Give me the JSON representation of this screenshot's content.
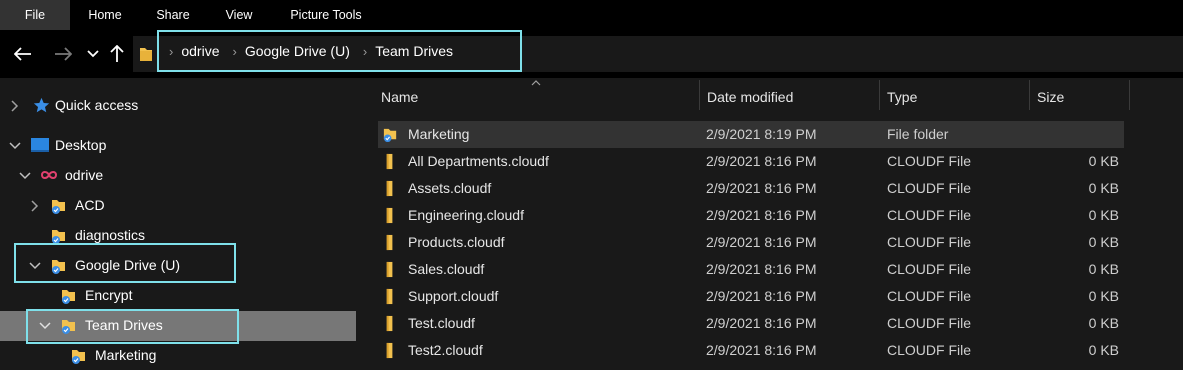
{
  "ribbon": {
    "tabs": [
      {
        "label": "File"
      },
      {
        "label": "Home"
      },
      {
        "label": "Share"
      },
      {
        "label": "View"
      },
      {
        "label": "Picture Tools"
      }
    ]
  },
  "address_bar": {
    "breadcrumb": [
      "odrive",
      "Google Drive (U)",
      "Team Drives"
    ]
  },
  "nav_pane": {
    "items": [
      {
        "label": "Quick access",
        "icon": "star-icon"
      },
      {
        "label": "Desktop",
        "icon": "desktop-icon"
      },
      {
        "label": "odrive",
        "icon": "odrive-infinity-icon"
      },
      {
        "label": "ACD",
        "icon": "sync-folder-icon"
      },
      {
        "label": "diagnostics",
        "icon": "sync-folder-icon"
      },
      {
        "label": "Google Drive (U)",
        "icon": "sync-folder-icon"
      },
      {
        "label": "Encrypt",
        "icon": "sync-folder-icon"
      },
      {
        "label": "Team Drives",
        "icon": "sync-folder-icon"
      },
      {
        "label": "Marketing",
        "icon": "sync-folder-icon"
      }
    ]
  },
  "file_list": {
    "columns": [
      "Name",
      "Date modified",
      "Type",
      "Size"
    ],
    "rows": [
      {
        "name": "Marketing",
        "date": "2/9/2021 8:19 PM",
        "type": "File folder",
        "size": "",
        "icon": "sync-folder-icon"
      },
      {
        "name": "All Departments.cloudf",
        "date": "2/9/2021 8:16 PM",
        "type": "CLOUDF File",
        "size": "0 KB",
        "icon": "folder-file-icon"
      },
      {
        "name": "Assets.cloudf",
        "date": "2/9/2021 8:16 PM",
        "type": "CLOUDF File",
        "size": "0 KB",
        "icon": "folder-file-icon"
      },
      {
        "name": "Engineering.cloudf",
        "date": "2/9/2021 8:16 PM",
        "type": "CLOUDF File",
        "size": "0 KB",
        "icon": "folder-file-icon"
      },
      {
        "name": "Products.cloudf",
        "date": "2/9/2021 8:16 PM",
        "type": "CLOUDF File",
        "size": "0 KB",
        "icon": "folder-file-icon"
      },
      {
        "name": "Sales.cloudf",
        "date": "2/9/2021 8:16 PM",
        "type": "CLOUDF File",
        "size": "0 KB",
        "icon": "folder-file-icon"
      },
      {
        "name": "Support.cloudf",
        "date": "2/9/2021 8:16 PM",
        "type": "CLOUDF File",
        "size": "0 KB",
        "icon": "folder-file-icon"
      },
      {
        "name": "Test.cloudf",
        "date": "2/9/2021 8:16 PM",
        "type": "CLOUDF File",
        "size": "0 KB",
        "icon": "folder-file-icon"
      },
      {
        "name": "Test2.cloudf",
        "date": "2/9/2021 8:16 PM",
        "type": "CLOUDF File",
        "size": "0 KB",
        "icon": "folder-file-icon"
      }
    ]
  },
  "colors": {
    "background": "#191919",
    "ribbon": "#000000",
    "highlight_outline": "#7fe0ea",
    "folder_yellow": "#f2c14e",
    "accent_blue": "#3a8ee6",
    "odrive_pink": "#e0406e"
  }
}
